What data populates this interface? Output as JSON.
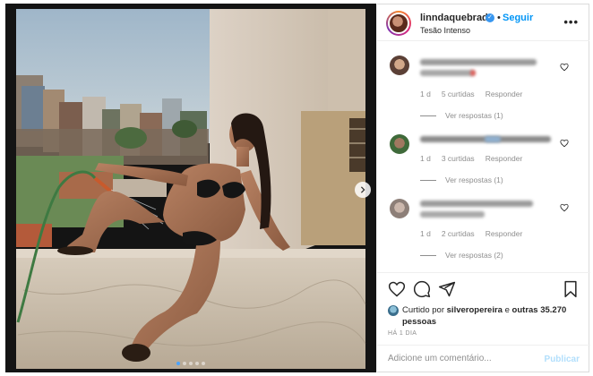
{
  "post": {
    "username": "linndaquebrada",
    "separator": "•",
    "follow_label": "Seguir",
    "subtitle": "Tesão Intenso",
    "more_label": "•••",
    "carousel": {
      "slide_count": 5,
      "active_slide": 1
    }
  },
  "comments": [
    {
      "time": "1 d",
      "likes": "5 curtidas",
      "reply": "Responder",
      "view_replies": "Ver respostas (1)"
    },
    {
      "time": "1 d",
      "likes": "3 curtidas",
      "reply": "Responder",
      "view_replies": "Ver respostas (1)"
    },
    {
      "time": "1 d",
      "likes": "2 curtidas",
      "reply": "Responder",
      "view_replies": "Ver respostas (2)"
    }
  ],
  "likes": {
    "prefix": "Curtido por",
    "user": "silveropereira",
    "conjunction": "e",
    "others": "outras 35.270 pessoas"
  },
  "date": "HÁ 1 DIA",
  "comment_box": {
    "placeholder": "Adicione um comentário...",
    "publish_label": "Publicar"
  },
  "colors": {
    "link_blue": "#0095f6",
    "verified_blue": "#3897f0",
    "muted_text": "#8e8e8e",
    "publish_disabled": "#b2dffc"
  },
  "icons": [
    "chevron-right-icon",
    "verified-icon",
    "heart-icon",
    "comment-icon",
    "share-icon",
    "bookmark-icon"
  ]
}
